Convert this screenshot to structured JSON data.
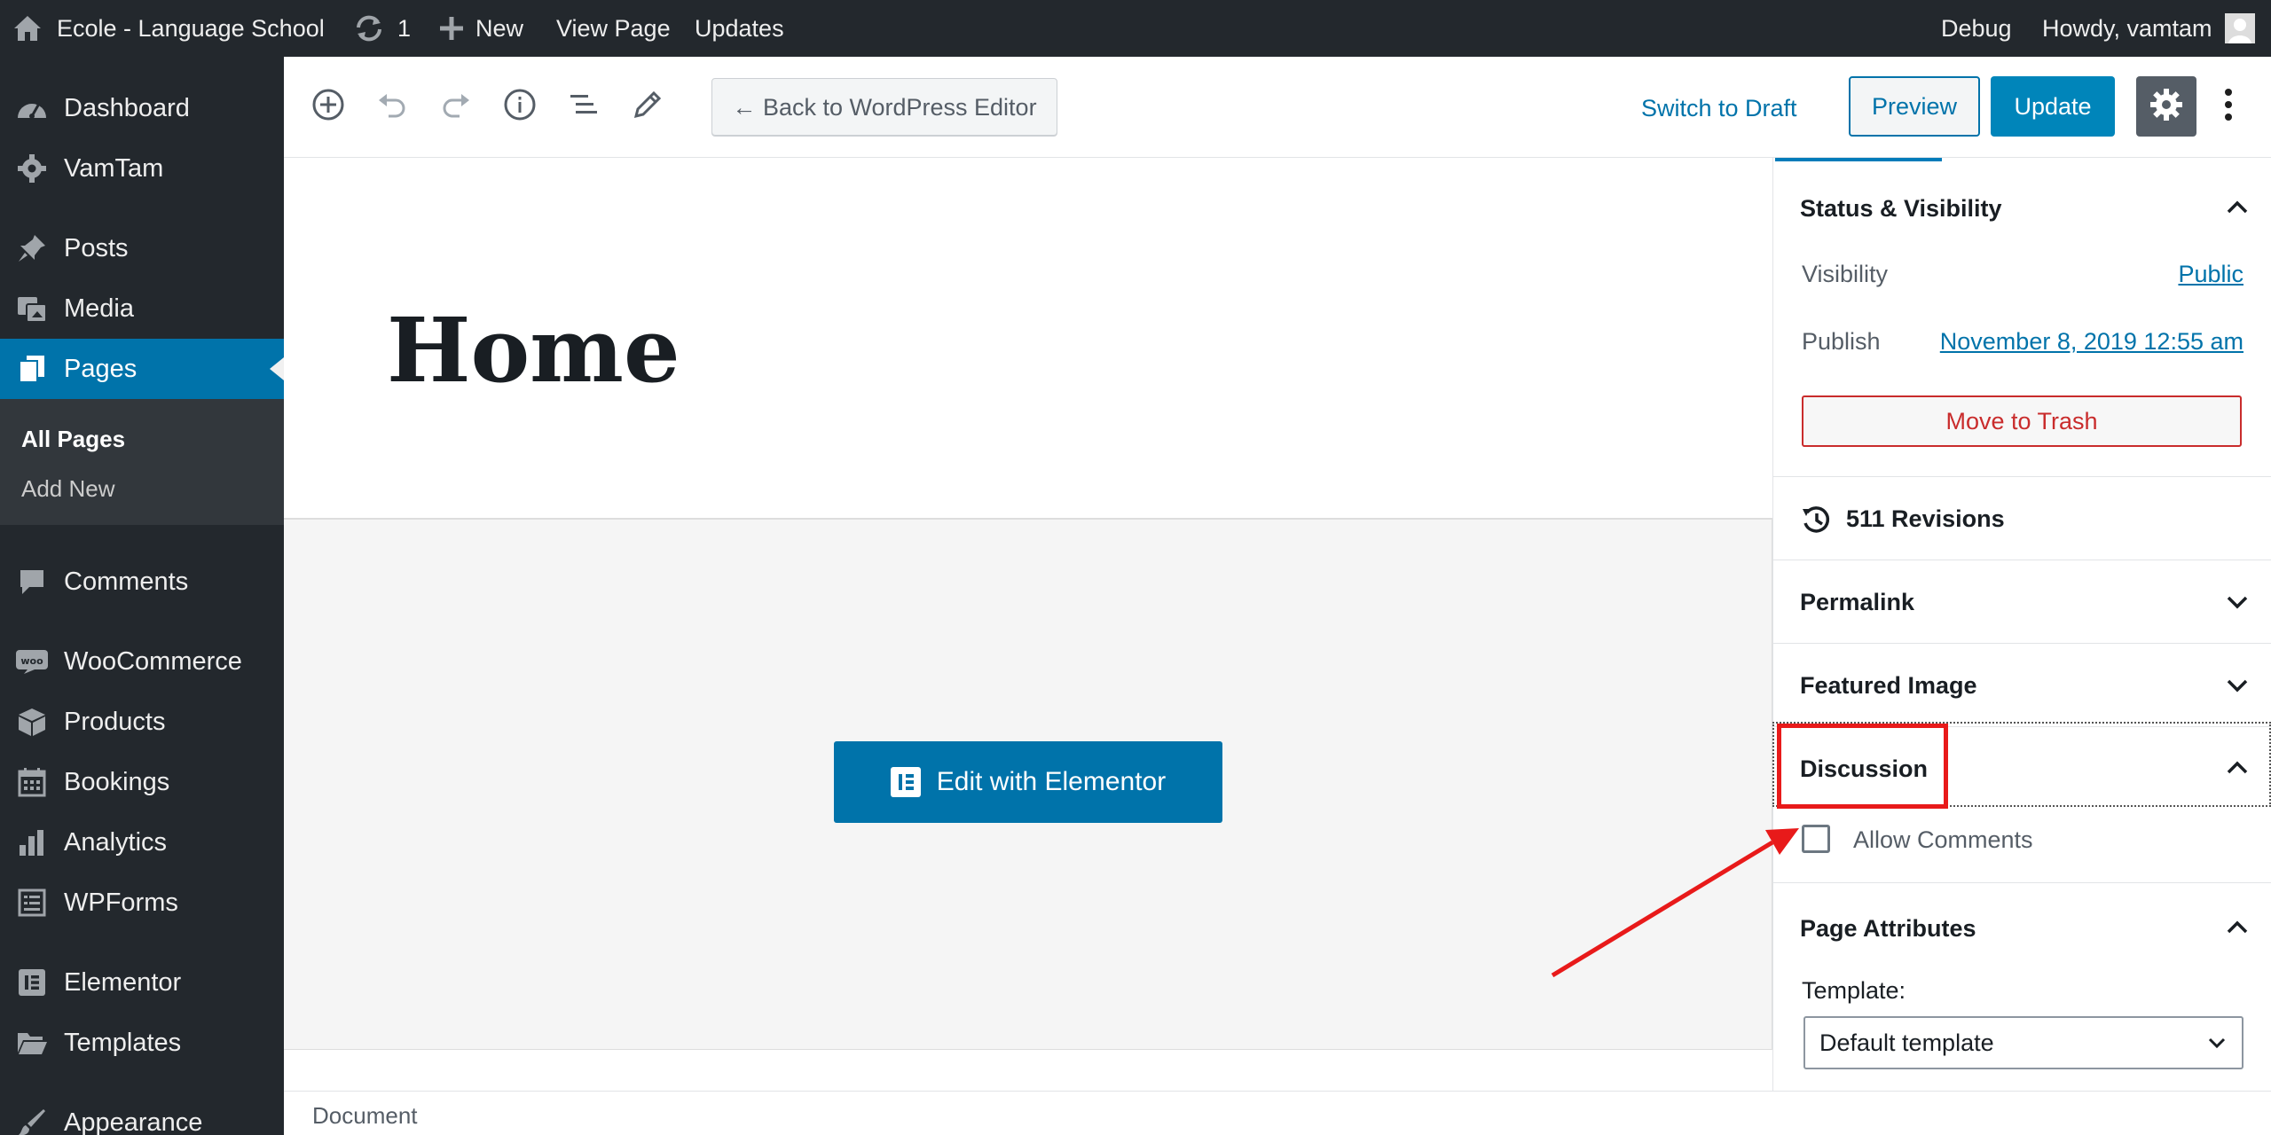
{
  "admin_bar": {
    "site_name": "Ecole - Language School",
    "updates_count": "1",
    "new_label": "New",
    "view_page_label": "View Page",
    "updates_label": "Updates",
    "debug_label": "Debug",
    "howdy_label": "Howdy, vamtam"
  },
  "sidebar": {
    "items": [
      {
        "label": "Dashboard",
        "icon": "dashboard-icon"
      },
      {
        "label": "VamTam",
        "icon": "gear-icon"
      },
      {
        "label": "Posts",
        "icon": "pin-icon"
      },
      {
        "label": "Media",
        "icon": "media-icon"
      },
      {
        "label": "Pages",
        "icon": "pages-icon",
        "current": true
      },
      {
        "label": "Comments",
        "icon": "comment-icon"
      },
      {
        "label": "WooCommerce",
        "icon": "woo-icon"
      },
      {
        "label": "Products",
        "icon": "box-icon"
      },
      {
        "label": "Bookings",
        "icon": "calendar-icon"
      },
      {
        "label": "Analytics",
        "icon": "bar-chart-icon"
      },
      {
        "label": "WPForms",
        "icon": "form-icon"
      },
      {
        "label": "Elementor",
        "icon": "elementor-icon"
      },
      {
        "label": "Templates",
        "icon": "folder-icon"
      },
      {
        "label": "Appearance",
        "icon": "brush-icon"
      }
    ],
    "submenu": [
      "All Pages",
      "Add New"
    ]
  },
  "toolbar": {
    "back_label": "← Back to WordPress Editor",
    "switch_draft_label": "Switch to Draft",
    "preview_label": "Preview",
    "update_label": "Update"
  },
  "content": {
    "title": "Home",
    "elementor_button": "Edit with Elementor"
  },
  "footer": {
    "breadcrumb": "Document"
  },
  "settings": {
    "status_title": "Status & Visibility",
    "visibility_label": "Visibility",
    "visibility_value": "Public",
    "publish_label": "Publish",
    "publish_value": "November 8, 2019 12:55 am",
    "trash_label": "Move to Trash",
    "revisions_label": "511 Revisions",
    "permalink_title": "Permalink",
    "featured_image_title": "Featured Image",
    "discussion_title": "Discussion",
    "allow_comments_label": "Allow Comments",
    "allow_comments_checked": false,
    "page_attributes_title": "Page Attributes",
    "template_label": "Template:",
    "template_value": "Default template"
  },
  "colors": {
    "admin_dark": "#23282d",
    "accent": "#0073aa",
    "annotation": "#e81a1a"
  }
}
